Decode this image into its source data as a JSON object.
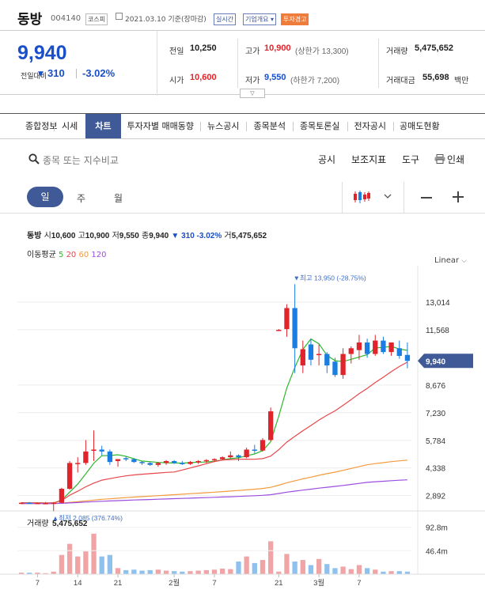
{
  "header": {
    "name": "동방",
    "code": "004140",
    "market": "코스피",
    "date": "2021.03.10 기준(장마감)",
    "tags": [
      "실시간",
      "기업개요 ▾",
      "투자경고"
    ]
  },
  "summary": {
    "price": "9,940",
    "change_label": "전일대비",
    "change": "310",
    "change_pct": "-3.02%",
    "prev_label": "전일",
    "prev": "10,250",
    "open_label": "시가",
    "open": "10,600",
    "high_label": "고가",
    "high": "10,900",
    "high_limit": "(상한가 13,300)",
    "low_label": "저가",
    "low": "9,550",
    "low_limit": "(하한가 7,200)",
    "volume_label": "거래량",
    "volume": "5,475,652",
    "amount_label": "거래대금",
    "amount": "55,698",
    "amount_unit": "백만"
  },
  "tabs": [
    "종합정보",
    "시세",
    "차트",
    "투자자별 매매동향",
    "뉴스공시",
    "종목분석",
    "종목토론실",
    "전자공시",
    "공매도현황"
  ],
  "active_tab": 2,
  "toolbar": {
    "search_placeholder": "종목 또는 지수비교",
    "disclosure": "공시",
    "indicator": "보조지표",
    "tools": "도구",
    "print": "인쇄"
  },
  "periods": {
    "day": "일",
    "week": "주",
    "month": "월"
  },
  "info": {
    "name": "동방",
    "open_label": "시",
    "open": "10,600",
    "high_label": "고",
    "high": "10,900",
    "low_label": "저",
    "low": "9,550",
    "close_label": "종",
    "close": "9,940",
    "change": "▼ 310 -3.02%",
    "vol_label": "거",
    "vol": "5,475,652"
  },
  "ma_legend": {
    "label": "이동평균",
    "p5": "5",
    "p20": "20",
    "p60": "60",
    "p120": "120"
  },
  "scale_label": "Linear",
  "colors": {
    "up": "#e0242b",
    "down": "#1a7de2",
    "ma5": "#2db82d",
    "ma20": "#e8464a",
    "ma60": "#f39a3d",
    "ma120": "#9b4de0",
    "accent": "#3f5a96"
  },
  "chart_data": {
    "type": "candlestick",
    "x_ticks": [
      "7",
      "14",
      "21",
      "2월",
      "7",
      "21",
      "3월",
      "7"
    ],
    "y_ticks": [
      13014,
      11568,
      8676,
      7230,
      5784,
      4338,
      2892
    ],
    "y_tick_labels": [
      "13,014",
      "11,568",
      "8,676",
      "7,230",
      "5,784",
      "4,338",
      "2,892"
    ],
    "ylim": [
      2300,
      14500
    ],
    "current_price": 9940,
    "current_price_label": "9,940",
    "max_label": "▼최고 13,950 (-28.75%)",
    "min_label": "▲최저 2,085 (376.74%)",
    "candles": [
      {
        "o": 2500,
        "h": 2550,
        "l": 2450,
        "c": 2520,
        "v": 3
      },
      {
        "o": 2520,
        "h": 2560,
        "l": 2480,
        "c": 2500,
        "v": 3
      },
      {
        "o": 2500,
        "h": 2540,
        "l": 2470,
        "c": 2510,
        "v": 3
      },
      {
        "o": 2480,
        "h": 2560,
        "l": 2450,
        "c": 2500,
        "v": 2
      },
      {
        "o": 2500,
        "h": 2560,
        "l": 2085,
        "c": 2520,
        "v": 5
      },
      {
        "o": 2520,
        "h": 3300,
        "l": 2500,
        "c": 3250,
        "v": 38
      },
      {
        "o": 3250,
        "h": 4700,
        "l": 3200,
        "c": 4600,
        "v": 60
      },
      {
        "o": 4600,
        "h": 4900,
        "l": 4100,
        "c": 4600,
        "v": 35
      },
      {
        "o": 4600,
        "h": 5800,
        "l": 4500,
        "c": 5200,
        "v": 45
      },
      {
        "o": 5300,
        "h": 6300,
        "l": 4700,
        "c": 5300,
        "v": 80
      },
      {
        "o": 5300,
        "h": 5500,
        "l": 5000,
        "c": 5200,
        "v": 35
      },
      {
        "o": 5200,
        "h": 5300,
        "l": 4500,
        "c": 4650,
        "v": 38
      },
      {
        "o": 4700,
        "h": 4800,
        "l": 4400,
        "c": 4800,
        "v": 12
      },
      {
        "o": 4850,
        "h": 4950,
        "l": 4700,
        "c": 4800,
        "v": 8
      },
      {
        "o": 4800,
        "h": 4850,
        "l": 4600,
        "c": 4650,
        "v": 9
      },
      {
        "o": 4650,
        "h": 4700,
        "l": 4500,
        "c": 4600,
        "v": 7
      },
      {
        "o": 4600,
        "h": 4650,
        "l": 4450,
        "c": 4500,
        "v": 8
      },
      {
        "o": 4500,
        "h": 4650,
        "l": 4400,
        "c": 4600,
        "v": 9
      },
      {
        "o": 4600,
        "h": 4750,
        "l": 4500,
        "c": 4700,
        "v": 7
      },
      {
        "o": 4700,
        "h": 4750,
        "l": 4550,
        "c": 4600,
        "v": 6
      },
      {
        "o": 4600,
        "h": 4700,
        "l": 4500,
        "c": 4550,
        "v": 5
      },
      {
        "o": 4550,
        "h": 4700,
        "l": 4500,
        "c": 4650,
        "v": 6
      },
      {
        "o": 4650,
        "h": 4750,
        "l": 4550,
        "c": 4700,
        "v": 7
      },
      {
        "o": 4700,
        "h": 4800,
        "l": 4600,
        "c": 4750,
        "v": 8
      },
      {
        "o": 4750,
        "h": 4850,
        "l": 4650,
        "c": 4800,
        "v": 9
      },
      {
        "o": 4800,
        "h": 4950,
        "l": 4750,
        "c": 4900,
        "v": 11
      },
      {
        "o": 4900,
        "h": 5200,
        "l": 4850,
        "c": 5000,
        "v": 10
      },
      {
        "o": 5000,
        "h": 5050,
        "l": 4700,
        "c": 4900,
        "v": 25
      },
      {
        "o": 4900,
        "h": 5400,
        "l": 4850,
        "c": 5300,
        "v": 35
      },
      {
        "o": 5300,
        "h": 5550,
        "l": 5100,
        "c": 5250,
        "v": 22
      },
      {
        "o": 5250,
        "h": 5900,
        "l": 5200,
        "c": 5800,
        "v": 28
      },
      {
        "o": 5800,
        "h": 7500,
        "l": 5750,
        "c": 7300,
        "v": 65
      },
      {
        "o": 11550,
        "h": 11600,
        "l": 11500,
        "c": 11560,
        "v": 5
      },
      {
        "o": 11600,
        "h": 12900,
        "l": 11200,
        "c": 12700,
        "v": 40
      },
      {
        "o": 12700,
        "h": 13950,
        "l": 9300,
        "c": 10600,
        "v": 25
      },
      {
        "o": 9700,
        "h": 11000,
        "l": 9300,
        "c": 10550,
        "v": 28
      },
      {
        "o": 10800,
        "h": 11100,
        "l": 9700,
        "c": 10000,
        "v": 18
      },
      {
        "o": 10300,
        "h": 10800,
        "l": 9700,
        "c": 10300,
        "v": 30
      },
      {
        "o": 10300,
        "h": 10400,
        "l": 9300,
        "c": 9700,
        "v": 20
      },
      {
        "o": 9900,
        "h": 10100,
        "l": 9100,
        "c": 9200,
        "v": 12
      },
      {
        "o": 9200,
        "h": 10600,
        "l": 9000,
        "c": 10300,
        "v": 15
      },
      {
        "o": 10300,
        "h": 10700,
        "l": 9800,
        "c": 10600,
        "v": 10
      },
      {
        "o": 10500,
        "h": 11300,
        "l": 10000,
        "c": 10900,
        "v": 18
      },
      {
        "o": 10900,
        "h": 11100,
        "l": 10100,
        "c": 10300,
        "v": 12
      },
      {
        "o": 10300,
        "h": 11300,
        "l": 10200,
        "c": 11000,
        "v": 9
      },
      {
        "o": 11000,
        "h": 11200,
        "l": 10300,
        "c": 10400,
        "v": 5
      },
      {
        "o": 10400,
        "h": 10900,
        "l": 10200,
        "c": 10900,
        "v": 6
      },
      {
        "o": 10600,
        "h": 11000,
        "l": 10050,
        "c": 10200,
        "v": 6
      },
      {
        "o": 10250,
        "h": 10900,
        "l": 9550,
        "c": 9940,
        "v": 5
      }
    ],
    "volume_label": "거래량",
    "volume_value": "5,475,652",
    "volume_y_ticks": [
      "92.8m",
      "46.4m"
    ]
  }
}
